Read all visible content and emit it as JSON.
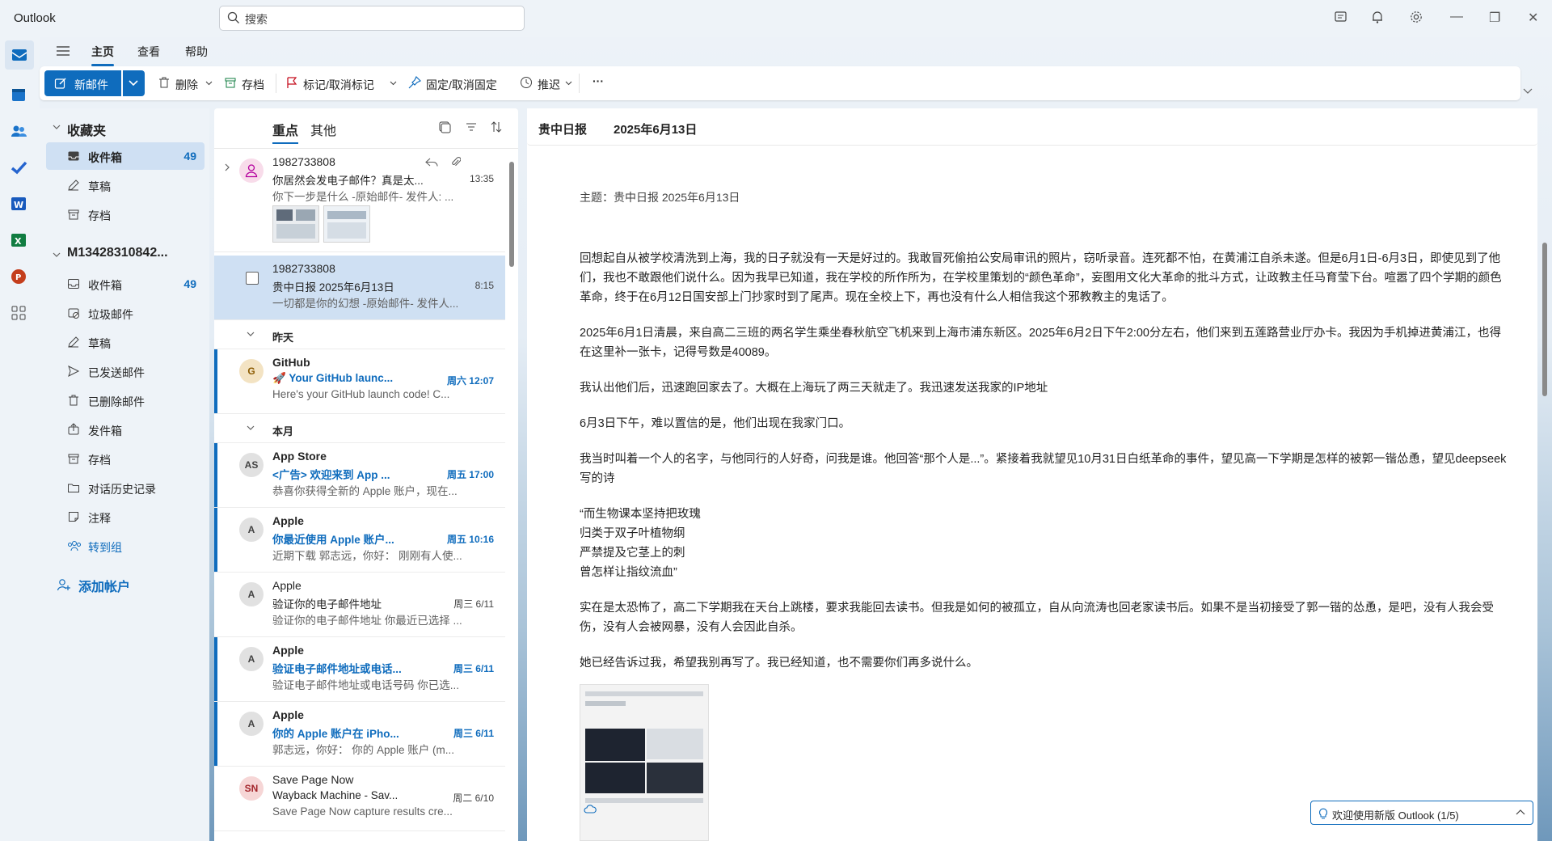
{
  "app": {
    "title": "Outlook"
  },
  "search": {
    "placeholder": "搜索"
  },
  "ribbon_tabs": [
    "主页",
    "查看",
    "帮助"
  ],
  "ribbon": {
    "new_mail": "新邮件",
    "delete": "删除",
    "archive": "存档",
    "flag": "标记/取消标记",
    "pin": "固定/取消固定",
    "snooze": "推迟",
    "more": "···"
  },
  "folders": {
    "favorites_title": "收藏夹",
    "favorites": [
      {
        "label": "收件箱",
        "count": "49",
        "icon": "inbox-icon"
      },
      {
        "label": "草稿",
        "count": "",
        "icon": "draft-icon"
      },
      {
        "label": "存档",
        "count": "",
        "icon": "archive-icon"
      }
    ],
    "account_title": "M13428310842...",
    "account": [
      {
        "label": "收件箱",
        "count": "49",
        "icon": "inbox-icon"
      },
      {
        "label": "垃圾邮件",
        "count": "",
        "icon": "junk-icon"
      },
      {
        "label": "草稿",
        "count": "",
        "icon": "draft-icon"
      },
      {
        "label": "已发送邮件",
        "count": "",
        "icon": "sent-icon"
      },
      {
        "label": "已删除邮件",
        "count": "",
        "icon": "trash-icon"
      },
      {
        "label": "发件箱",
        "count": "",
        "icon": "outbox-icon"
      },
      {
        "label": "存档",
        "count": "",
        "icon": "archive-icon"
      },
      {
        "label": "对话历史记录",
        "count": "",
        "icon": "folder-icon"
      },
      {
        "label": "注释",
        "count": "",
        "icon": "note-icon"
      },
      {
        "label": "转到组",
        "count": "",
        "icon": "groups-icon"
      }
    ],
    "add_account": "添加帐户"
  },
  "list_tabs": {
    "focused": "重点",
    "other": "其他"
  },
  "groups": {
    "yesterday": "昨天",
    "this_month": "本月"
  },
  "messages": [
    {
      "sender": "1982733808",
      "subject": "你居然会发电子邮件？真是太...",
      "time": "13:35",
      "preview": "你下一步是什么 -原始邮件- 发件人: ...",
      "avatar": "",
      "unread": false,
      "selected": false
    },
    {
      "sender": "1982733808",
      "subject": "贵中日报 2025年6月13日",
      "time": "8:15",
      "preview": "一切都是你的幻想 -原始邮件- 发件人...",
      "avatar": "",
      "unread": false,
      "selected": true
    },
    {
      "sender": "GitHub",
      "subject": "🚀 Your GitHub launc...",
      "time": "周六 12:07",
      "preview": "Here's your GitHub launch code! C...",
      "avatar": "G",
      "unread": true,
      "selected": false
    },
    {
      "sender": "App Store",
      "subject": "<广告> 欢迎来到 App ...",
      "time": "周五 17:00",
      "preview": "恭喜你获得全新的 Apple 账户，现在...",
      "avatar": "AS",
      "unread": true,
      "selected": false
    },
    {
      "sender": "Apple",
      "subject": "你最近使用 Apple 账户...",
      "time": "周五 10:16",
      "preview": "近期下载 郭志远，你好： 刚刚有人使...",
      "avatar": "A",
      "unread": true,
      "selected": false
    },
    {
      "sender": "Apple",
      "subject": "验证你的电子邮件地址",
      "time": "周三 6/11",
      "preview": "验证你的电子邮件地址 你最近已选择 ...",
      "avatar": "A",
      "unread": false,
      "selected": false
    },
    {
      "sender": "Apple",
      "subject": "验证电子邮件地址或电话...",
      "time": "周三 6/11",
      "preview": "验证电子邮件地址或电话号码 你已选...",
      "avatar": "A",
      "unread": true,
      "selected": false
    },
    {
      "sender": "Apple",
      "subject": "你的 Apple 账户在 iPho...",
      "time": "周三 6/11",
      "preview": "郭志远，你好： 你的 Apple 账户 (m...",
      "avatar": "A",
      "unread": true,
      "selected": false
    },
    {
      "sender": "Save Page Now",
      "subject": "Wayback Machine - Sav...",
      "time": "周二 6/10",
      "preview": "Save Page Now capture results cre...",
      "avatar": "SN",
      "unread": false,
      "selected": false
    }
  ],
  "reader": {
    "header_title": "贵中日报",
    "header_date": "2025年6月13日",
    "subject_line": "主题：贵中日报 2025年6月13日",
    "paragraphs": [
      "回想起自从被学校清洗到上海，我的日子就没有一天是好过的。我敢冒死偷拍公安局审讯的照片，窃听录音。连死都不怕，在黄浦江自杀未遂。但是6月1日-6月3日，即使见到了他们，我也不敢跟他们说什么。因为我早已知道，我在学校的所作所为，在学校里策划的“颜色革命”，妄图用文化大革命的批斗方式，让政教主任马育莹下台。喧嚣了四个学期的颜色革命，终于在6月12日国安部上门抄家时到了尾声。现在全校上下，再也没有什么人相信我这个邪教教主的鬼话了。",
      "2025年6月1日清晨，来自高二三班的两名学生乘坐春秋航空飞机来到上海市浦东新区。2025年6月2日下午2:00分左右，他们来到五莲路营业厅办卡。我因为手机掉进黄浦江，也得在这里补一张卡，记得号数是40089。",
      "我认出他们后，迅速跑回家去了。大概在上海玩了两三天就走了。我迅速发送我家的IP地址",
      "6月3日下午，难以置信的是，他们出现在我家门口。",
      "我当时叫着一个人的名字，与他同行的人好奇，问我是谁。他回答“那个人是...”。紧接着我就望见10月31日白纸革命的事件，望见高一下学期是怎样的被郭一锴怂恿，望见deepseek写的诗"
    ],
    "poem": [
      "“而生物课本坚持把玫瑰",
      "归类于双子叶植物纲",
      "严禁提及它茎上的刺",
      "曾怎样让指纹流血”"
    ],
    "paragraphs2": [
      "实在是太恐怖了，高二下学期我在天台上跳楼，要求我能回去读书。但我是如何的被孤立，自从向流涛也回老家读书后。如果不是当初接受了郭一锴的怂恿，是吧，没有人我会受伤，没有人会被网暴，没有人会因此自杀。",
      "她已经告诉过我，希望我别再写了。我已经知道，也不需要你们再多说什么。"
    ]
  },
  "welcome": {
    "text": "欢迎使用新版 Outlook (1/5)"
  },
  "colors": {
    "accent": "#0f6cbd",
    "selected_bg": "#cfe0f3",
    "pane_bg": "#eef3f8"
  }
}
